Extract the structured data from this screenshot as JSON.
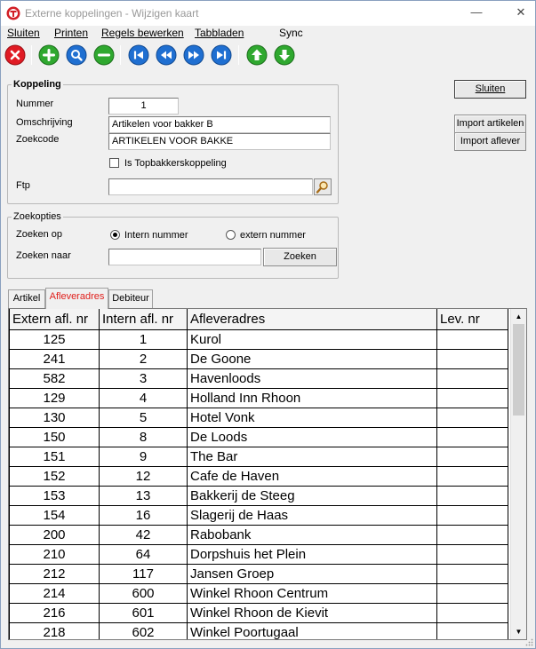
{
  "window": {
    "title": "Externe koppelingen - Wijzigen kaart"
  },
  "window_controls": {
    "minimize": "—",
    "close": "✕"
  },
  "menu": {
    "items": [
      {
        "label": "Sluiten"
      },
      {
        "label": "Printen"
      },
      {
        "label": "Regels bewerken"
      },
      {
        "label": "Tabbladen"
      },
      {
        "label": "Sync"
      }
    ]
  },
  "toolbar": {
    "buttons": [
      {
        "icon": "close-icon",
        "color": "#e01b24"
      },
      {
        "icon": "add-icon",
        "color": "#2fa82f"
      },
      {
        "icon": "search-icon",
        "color": "#1f6fd1"
      },
      {
        "icon": "remove-icon",
        "color": "#2fa82f"
      },
      {
        "icon": "first-icon",
        "color": "#1f6fd1"
      },
      {
        "icon": "previous-icon",
        "color": "#1f6fd1"
      },
      {
        "icon": "next-icon",
        "color": "#1f6fd1"
      },
      {
        "icon": "last-icon",
        "color": "#1f6fd1"
      },
      {
        "icon": "arrow-up-icon",
        "color": "#2fa82f"
      },
      {
        "icon": "arrow-down-icon",
        "color": "#2fa82f"
      }
    ]
  },
  "koppeling": {
    "legend": "Koppeling",
    "nummer_label": "Nummer",
    "nummer_value": "1",
    "omschrijving_label": "Omschrijving",
    "omschrijving_value": "Artikelen voor bakker B",
    "zoekcode_label": "Zoekcode",
    "zoekcode_value": "ARTIKELEN VOOR BAKKE",
    "topbakkers_label": "Is Topbakkerskoppeling",
    "topbakkers_checked": false,
    "ftp_label": "Ftp",
    "ftp_value": ""
  },
  "side_buttons": {
    "sluiten": "Sluiten",
    "import_artikelen": "Import artikelen",
    "import_aflever": "Import aflever"
  },
  "zoekopties": {
    "legend": "Zoekopties",
    "zoeken_op_label": "Zoeken op",
    "radio_intern": "Intern nummer",
    "radio_extern": "extern nummer",
    "selected": "intern",
    "zoeken_naar_label": "Zoeken naar",
    "zoeken_naar_value": "",
    "zoeken_button": "Zoeken"
  },
  "tabs": [
    {
      "label": "Artikel",
      "active": false
    },
    {
      "label": "Afleveradres",
      "active": true
    },
    {
      "label": "Debiteur",
      "active": false
    }
  ],
  "grid": {
    "columns": [
      "Extern afl. nr",
      "Intern afl. nr",
      "Afleveradres",
      "Lev. nr"
    ],
    "rows": [
      [
        "125",
        "1",
        "Kurol",
        ""
      ],
      [
        "241",
        "2",
        "De Goone",
        ""
      ],
      [
        "582",
        "3",
        "Havenloods",
        ""
      ],
      [
        "129",
        "4",
        "Holland Inn Rhoon",
        ""
      ],
      [
        "130",
        "5",
        "Hotel Vonk",
        ""
      ],
      [
        "150",
        "8",
        "De Loods",
        ""
      ],
      [
        "151",
        "9",
        "The Bar",
        ""
      ],
      [
        "152",
        "12",
        "Cafe de Haven",
        ""
      ],
      [
        "153",
        "13",
        "Bakkerij de Steeg",
        ""
      ],
      [
        "154",
        "16",
        "Slagerij de Haas",
        ""
      ],
      [
        "200",
        "42",
        "Rabobank",
        ""
      ],
      [
        "210",
        "64",
        "Dorpshuis het Plein",
        ""
      ],
      [
        "212",
        "117",
        "Jansen Groep",
        ""
      ],
      [
        "214",
        "600",
        "Winkel Rhoon Centrum",
        ""
      ],
      [
        "216",
        "601",
        "Winkel Rhoon de Kievit",
        ""
      ],
      [
        "218",
        "602",
        "Winkel Poortugaal",
        ""
      ]
    ]
  }
}
